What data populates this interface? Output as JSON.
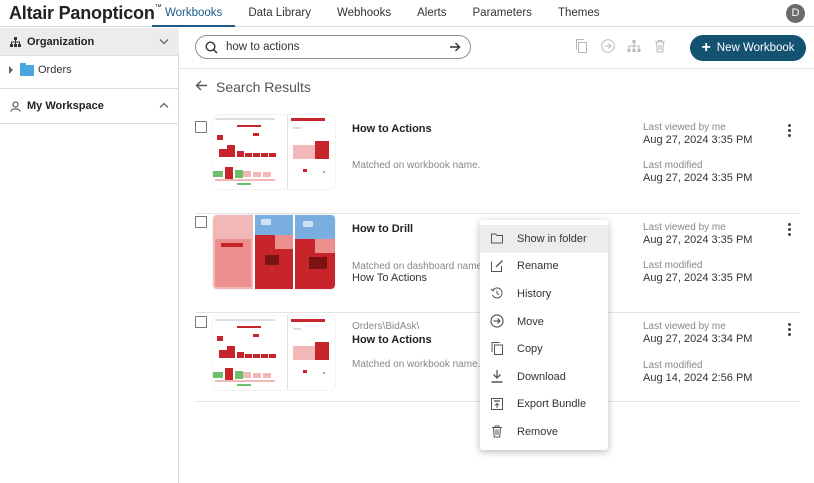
{
  "app": {
    "logo": "Altair Panopticon",
    "logo_mark": "™",
    "user_initial": "D"
  },
  "nav": {
    "tabs": [
      "Workbooks",
      "Data Library",
      "Webhooks",
      "Alerts",
      "Parameters",
      "Themes"
    ],
    "active": 0
  },
  "sidebar": {
    "organization": "Organization",
    "org_items": [
      "Orders"
    ],
    "my_workspace": "My Workspace"
  },
  "search": {
    "value": "how to actions",
    "placeholder": ""
  },
  "toolbar": {
    "new_workbook": "New Workbook"
  },
  "results": {
    "title": "Search Results",
    "rows": [
      {
        "path": "",
        "name": "How to Actions",
        "match": "Matched on workbook name.",
        "match_detail": "",
        "viewed_label": "Last viewed by me",
        "viewed": "Aug 27, 2024 3:35 PM",
        "modified_label": "Last modified",
        "modified": "Aug 27, 2024 3:35 PM"
      },
      {
        "path": "",
        "name": "How to Drill",
        "match": "Matched on dashboard name:",
        "match_detail": "How To Actions",
        "viewed_label": "Last viewed by me",
        "viewed": "Aug 27, 2024 3:35 PM",
        "modified_label": "Last modified",
        "modified": "Aug 27, 2024 3:35 PM"
      },
      {
        "path": "Orders\\BidAsk\\",
        "name": "How to Actions",
        "match": "Matched on workbook name.",
        "match_detail": "",
        "viewed_label": "Last viewed by me",
        "viewed": "Aug 27, 2024 3:34 PM",
        "modified_label": "Last modified",
        "modified": "Aug 14, 2024 2:56 PM"
      }
    ]
  },
  "context_menu": {
    "items": [
      "Show in folder",
      "Rename",
      "History",
      "Move",
      "Copy",
      "Download",
      "Export Bundle",
      "Remove"
    ],
    "highlighted": 0
  },
  "colors": {
    "accent": "#145272",
    "active_tab": "#1a5b8a",
    "thumb_red": "#c8242b",
    "thumb_pink": "#f2b8b8",
    "thumb_green": "#6cc06a",
    "thumb_blue": "#7aaee0"
  }
}
